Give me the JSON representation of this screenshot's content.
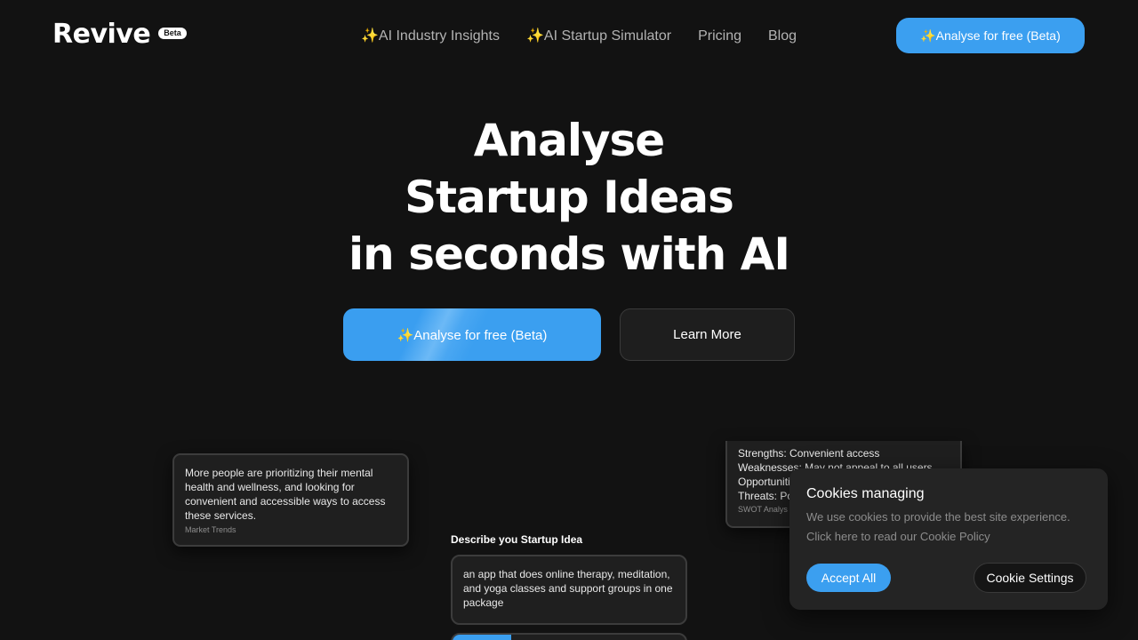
{
  "header": {
    "logo": "Revive",
    "badge": "Beta",
    "nav": [
      {
        "label": "✨AI Industry Insights"
      },
      {
        "label": "✨AI Startup Simulator"
      },
      {
        "label": "Pricing"
      },
      {
        "label": "Blog"
      }
    ],
    "cta": "✨Analyse for free (Beta)"
  },
  "hero": {
    "lines": [
      "Analyse",
      "Startup Ideas",
      "in seconds with AI"
    ],
    "primary_button": "✨Analyse for free (Beta)",
    "secondary_button": "Learn More"
  },
  "preview": {
    "market_trend": {
      "text": "More people are prioritizing their mental health and wellness, and looking for convenient and accessible ways to access these services.",
      "tag": "Market Trends"
    },
    "swot": {
      "lines": [
        "Strengths: Convenient access",
        "Weaknesses: May not appeal to all users",
        "Opportunities:",
        "Threats: Po"
      ],
      "tag": "SWOT Analys"
    },
    "idea_form": {
      "label": "Describe you Startup Idea",
      "value": "an app that does online therapy, meditation, and yoga classes and support groups in one package"
    }
  },
  "cookie": {
    "title": "Cookies managing",
    "body_line1": "We use cookies to provide the best site experience.",
    "body_line2": "Click here to read our Cookie Policy",
    "accept": "Accept All",
    "settings": "Cookie Settings"
  },
  "colors": {
    "background": "#121212",
    "accent": "#3b9ff0",
    "card": "#1f1f1f",
    "muted_text": "#b3b3b3"
  }
}
